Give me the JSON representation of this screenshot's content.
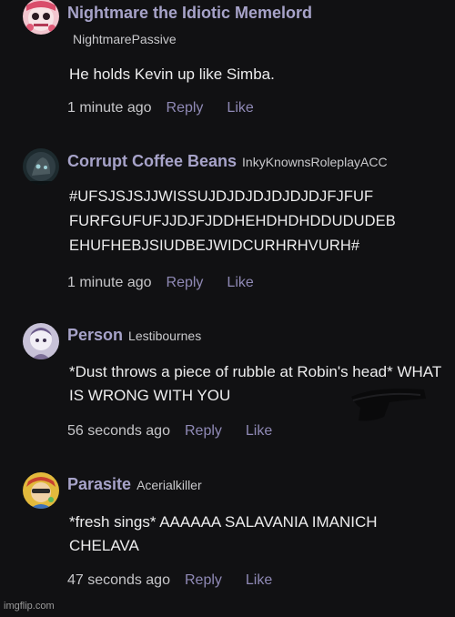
{
  "comments": [
    {
      "display_name": "Nightmare the Idiotic Memelord",
      "username": "NightmarePassive",
      "text": "He holds Kevin up like Simba.",
      "time": "1 minute ago",
      "reply_label": "Reply",
      "like_label": "Like",
      "avatar": "nightmare-avatar"
    },
    {
      "display_name": "Corrupt Coffee Beans",
      "username": "InkyKnownsRoleplayACC",
      "text": "#UFSJSJSJJWISSUJDJDJDJDJDJDJFJFUF\nFURFGUFUFJJDJFJDDHEHDHDHDDUDUDEB\nEHUFHEBJSIUDBEJWIDCURHRHVURH#",
      "time": "1 minute ago",
      "reply_label": "Reply",
      "like_label": "Like",
      "avatar": "coffee-beans-avatar"
    },
    {
      "display_name": "Person",
      "username": "Lestibournes",
      "text": "*Dust throws a piece of rubble at Robin's head* WHAT IS WRONG WITH YOU",
      "time": "56 seconds ago",
      "reply_label": "Reply",
      "like_label": "Like",
      "avatar": "person-avatar"
    },
    {
      "display_name": "Parasite",
      "username": "Acerialkiller",
      "text": "*fresh sings* AAAAAA SALAVANIA IMANICH CHELAVA",
      "time": "47 seconds ago",
      "reply_label": "Reply",
      "like_label": "Like",
      "avatar": "parasite-avatar"
    }
  ],
  "watermark": "imgflip.com",
  "colors": {
    "background": "#111113",
    "display_name": "#a7a3c9",
    "action_link": "#8f89b5",
    "body_text": "#ededee",
    "timestamp": "#c6c6c9"
  }
}
